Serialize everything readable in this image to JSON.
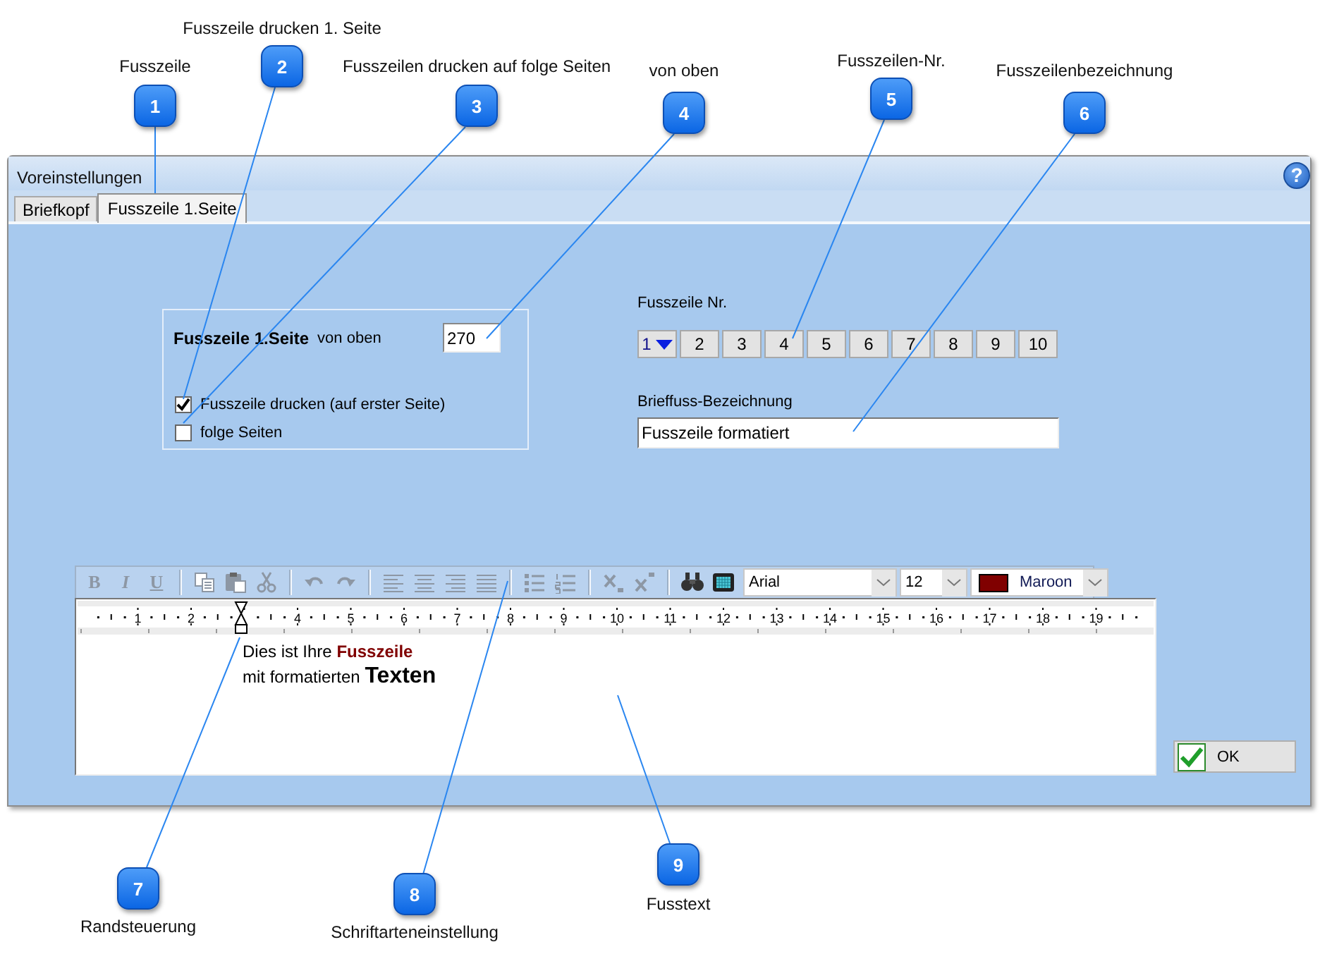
{
  "window": {
    "title": "Voreinstellungen",
    "help_button": "?"
  },
  "tabs": [
    {
      "label": "Briefkopf",
      "selected": false
    },
    {
      "label": "Fusszeile 1.Seite",
      "selected": true
    }
  ],
  "footer_group": {
    "title": "Fusszeile 1.Seite",
    "position_label": "von oben",
    "position_value": "270",
    "checkboxes": [
      {
        "label": "Fusszeile drucken (auf erster Seite)",
        "checked": true
      },
      {
        "label": "folge Seiten",
        "checked": false
      }
    ]
  },
  "footer_number": {
    "label": "Fusszeile Nr.",
    "buttons": [
      {
        "label": "1",
        "selected": true
      },
      {
        "label": "2",
        "selected": false
      },
      {
        "label": "3",
        "selected": false
      },
      {
        "label": "4",
        "selected": false
      },
      {
        "label": "5",
        "selected": false
      },
      {
        "label": "6",
        "selected": false
      },
      {
        "label": "7",
        "selected": false
      },
      {
        "label": "8",
        "selected": false
      },
      {
        "label": "9",
        "selected": false
      },
      {
        "label": "10",
        "selected": false
      }
    ]
  },
  "footer_name": {
    "label": "Brieffuss-Bezeichnung",
    "value": "Fusszeile formatiert"
  },
  "editor": {
    "toolbar": {
      "format_buttons": [
        {
          "label": "B",
          "kind": "bold",
          "disabled": true
        },
        {
          "label": "I",
          "kind": "italic",
          "disabled": true
        },
        {
          "label": "U",
          "kind": "underline",
          "disabled": true
        }
      ],
      "font": "Arial",
      "size": "12",
      "color_name": "Maroon",
      "color": "#800000"
    },
    "ruler": {
      "before_marker": [
        "1",
        "2"
      ],
      "after_marker": [
        "4",
        "5",
        "6",
        "7",
        "8",
        "9",
        "10",
        "11",
        "12",
        "13",
        "14",
        "15",
        "16",
        "17",
        "18",
        "19"
      ]
    },
    "lines": [
      {
        "text": "Dies ist Ihre **Fusszeile**",
        "kind": "accent"
      },
      {
        "text": "mit formatierten **Texten**",
        "kind": "large"
      }
    ]
  },
  "ok_button": "OK",
  "callouts": [
    {
      "number": "1",
      "label": "Fusszeile"
    },
    {
      "number": "2",
      "label": "Fusszeile drucken 1. Seite"
    },
    {
      "number": "3",
      "label": "Fusszeilen drucken auf folge Seiten"
    },
    {
      "number": "4",
      "label": "von oben"
    },
    {
      "number": "5",
      "label": "Fusszeilen-Nr."
    },
    {
      "number": "6",
      "label": "Fusszeilenbezeichnung"
    },
    {
      "number": "7",
      "label": "Randsteuerung"
    },
    {
      "number": "8",
      "label": "Schriftarteneinstellung"
    },
    {
      "number": "9",
      "label": "Fusstext"
    }
  ]
}
